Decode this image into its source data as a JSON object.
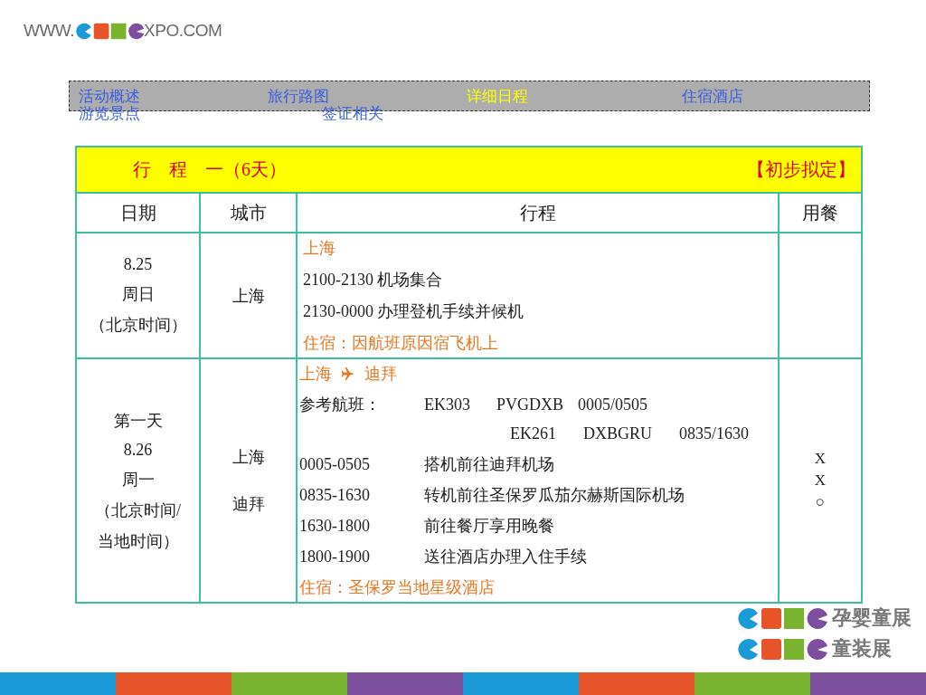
{
  "header": {
    "logo_prefix": "WWW.",
    "logo_suffix": "XPO.COM"
  },
  "nav": {
    "rows": [
      [
        {
          "label": "活动概述",
          "selected": false
        },
        {
          "label": "旅行路图",
          "selected": false
        },
        {
          "label": "详细日程",
          "selected": true
        },
        {
          "label": "住宿酒店",
          "selected": false
        }
      ],
      [
        {
          "label": "游览景点",
          "selected": false
        },
        {
          "label": "签证相关",
          "selected": false
        }
      ]
    ]
  },
  "table": {
    "title": "行　程　一（6天）",
    "status": "【初步拟定】",
    "columns": [
      "日期",
      "城市",
      "行程",
      "用餐"
    ],
    "rows": [
      {
        "date": [
          "8.25",
          "周日",
          "（北京时间）"
        ],
        "city": [
          "上海"
        ],
        "meals": [],
        "itinerary": [
          {
            "kind": "place",
            "text": "上海"
          },
          {
            "kind": "text",
            "text": "2100-2130 机场集合"
          },
          {
            "kind": "text",
            "text": "2130-0000 办理登机手续并候机"
          },
          {
            "kind": "place",
            "text": "住宿：因航班原因宿飞机上"
          }
        ]
      },
      {
        "date": [
          "第一天",
          "8.26",
          "周一",
          "（北京时间/",
          "当地时间）"
        ],
        "city": [
          "上海",
          "迪拜"
        ],
        "meals": [
          "X",
          "X",
          "○"
        ],
        "itinerary": [
          {
            "kind": "route",
            "from": "上海",
            "to": "迪拜"
          },
          {
            "kind": "flights",
            "label": "参考航班：",
            "flights": [
              [
                "EK303",
                "PVGDXB",
                "0005/0505"
              ],
              [
                "EK261",
                "DXBGRU",
                "0835/1630"
              ]
            ]
          },
          {
            "kind": "activity",
            "time": "0005-0505",
            "text": "搭机前往迪拜机场"
          },
          {
            "kind": "activity",
            "time": "0835-1630",
            "text": "转机前往圣保罗瓜茄尔赫斯国际机场"
          },
          {
            "kind": "activity",
            "time": "1630-1800",
            "text": "前往餐厅享用晚餐"
          },
          {
            "kind": "activity",
            "time": "1800-1900",
            "text": "送往酒店办理入住手续"
          },
          {
            "kind": "place",
            "text": "住宿：圣保罗当地星级酒店"
          }
        ]
      }
    ]
  },
  "brand": {
    "lines": [
      "孕婴童展",
      "童装展"
    ]
  }
}
